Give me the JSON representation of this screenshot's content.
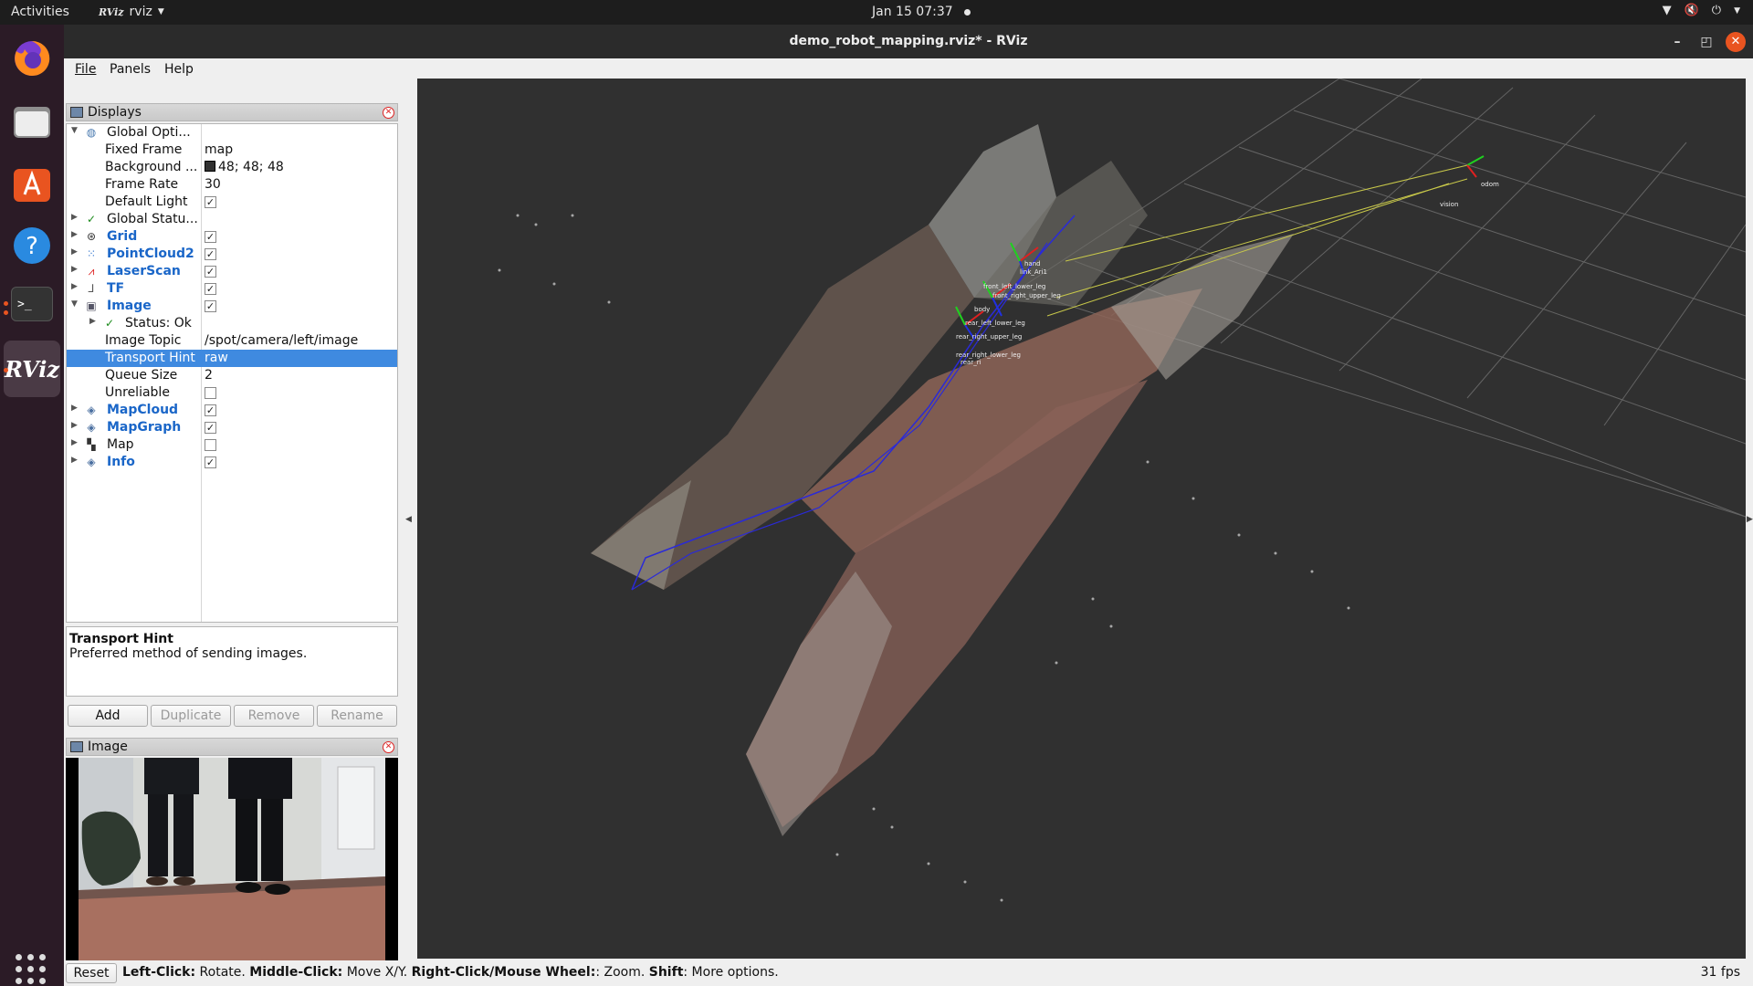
{
  "topbar": {
    "activities": "Activities",
    "app_logo": "RViz",
    "app_name": "rviz",
    "datetime": "Jan 15  07:37"
  },
  "dock": {
    "items": [
      "firefox-icon",
      "files-icon",
      "software-center-icon",
      "help-icon",
      "terminal-icon",
      "rviz-icon"
    ],
    "rviz_label": "RViz",
    "terminal_label": ">_"
  },
  "window": {
    "title": "demo_robot_mapping.rviz* - RViz"
  },
  "menu": {
    "file": "File",
    "panels": "Panels",
    "help": "Help"
  },
  "displays": {
    "title": "Displays",
    "rows": [
      {
        "label": "Global Opti...",
        "value": ""
      },
      {
        "label": "Fixed Frame",
        "value": "map"
      },
      {
        "label": "Background ...",
        "value": "48; 48; 48"
      },
      {
        "label": "Frame Rate",
        "value": "30"
      },
      {
        "label": "Default Light",
        "value": "✓"
      },
      {
        "label": "Global Statu...",
        "value": ""
      },
      {
        "label": "Grid",
        "value": "✓"
      },
      {
        "label": "PointCloud2",
        "value": "✓"
      },
      {
        "label": "LaserScan",
        "value": "✓"
      },
      {
        "label": "TF",
        "value": "✓"
      },
      {
        "label": "Image",
        "value": "✓"
      },
      {
        "label": "Status: Ok",
        "value": ""
      },
      {
        "label": "Image Topic",
        "value": "/spot/camera/left/image"
      },
      {
        "label": "Transport Hint",
        "value": "raw"
      },
      {
        "label": "Queue Size",
        "value": "2"
      },
      {
        "label": "Unreliable",
        "value": ""
      },
      {
        "label": "MapCloud",
        "value": "✓"
      },
      {
        "label": "MapGraph",
        "value": "✓"
      },
      {
        "label": "Map",
        "value": ""
      },
      {
        "label": "Info",
        "value": "✓"
      }
    ]
  },
  "description": {
    "title": "Transport Hint",
    "text": "Preferred method of sending images."
  },
  "buttons": {
    "add": "Add",
    "duplicate": "Duplicate",
    "remove": "Remove",
    "rename": "Rename"
  },
  "image_panel": {
    "title": "Image"
  },
  "statusbar": {
    "reset": "Reset",
    "left_click": "Left-Click:",
    "left_click_action": " Rotate. ",
    "middle_click": "Middle-Click:",
    "middle_click_action": " Move X/Y. ",
    "right_click": "Right-Click/Mouse Wheel:",
    "right_click_action": ": Zoom. ",
    "shift": "Shift",
    "shift_action": ": More options.",
    "fps": "31 fps"
  },
  "scene": {
    "frame_labels": [
      "hand",
      "link_Ari1",
      "front_left_lower_leg",
      "front_right_upper_leg",
      "body",
      "rear_left_lower_leg",
      "rear_right_upper_leg",
      "rear_right_lower_leg",
      "rear_ri"
    ],
    "far_labels": [
      "odom",
      "vision"
    ]
  },
  "colors": {
    "view_bg": "#303030",
    "selection": "#3f8ae0",
    "display_blue": "#1a66c8",
    "ubuntu_orange": "#e95420"
  }
}
